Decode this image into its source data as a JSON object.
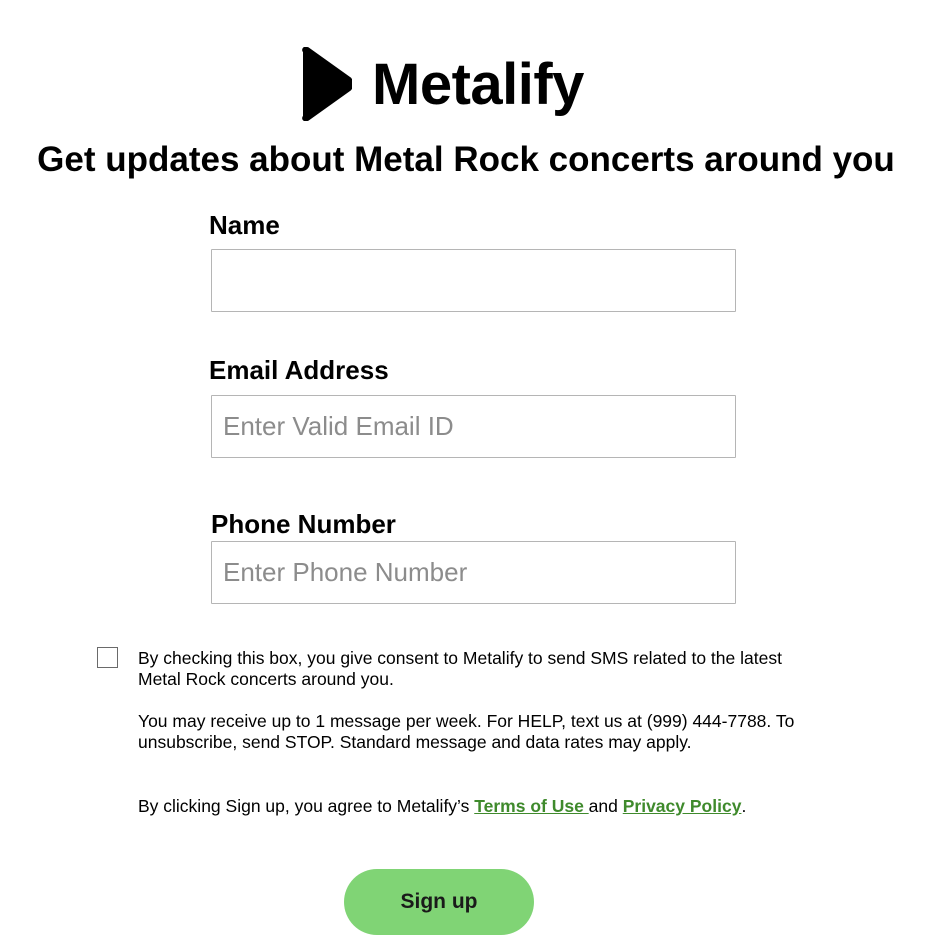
{
  "brand": {
    "name": "Metalify",
    "logo_icon": "play-icon"
  },
  "headline": "Get updates about Metal Rock concerts around you",
  "form": {
    "name": {
      "label": "Name",
      "placeholder": "",
      "value": ""
    },
    "email": {
      "label": "Email Address",
      "placeholder": "Enter Valid Email ID",
      "value": ""
    },
    "phone": {
      "label": "Phone Number",
      "placeholder": "Enter Phone Number",
      "value": ""
    },
    "consent": {
      "checked": false,
      "text": "By checking this box, you give consent to Metalify to send SMS related to the latest Metal Rock concerts around you."
    }
  },
  "legal": {
    "sms_notice": "You may receive up to 1 message per week. For HELP, text us at (999) 444-7788. To unsubscribe, send STOP. Standard message and data rates may apply.",
    "agree_prefix": "By clicking Sign up, you agree to Metalify’s ",
    "terms_link": "Terms of Use ",
    "and_text": "and ",
    "privacy_link": "Privacy Policy",
    "agree_suffix": "."
  },
  "signup_button": {
    "label": "Sign up"
  },
  "colors": {
    "link": "#3f8a2c",
    "button": "#80d475",
    "input_border": "#b5b5b5"
  }
}
